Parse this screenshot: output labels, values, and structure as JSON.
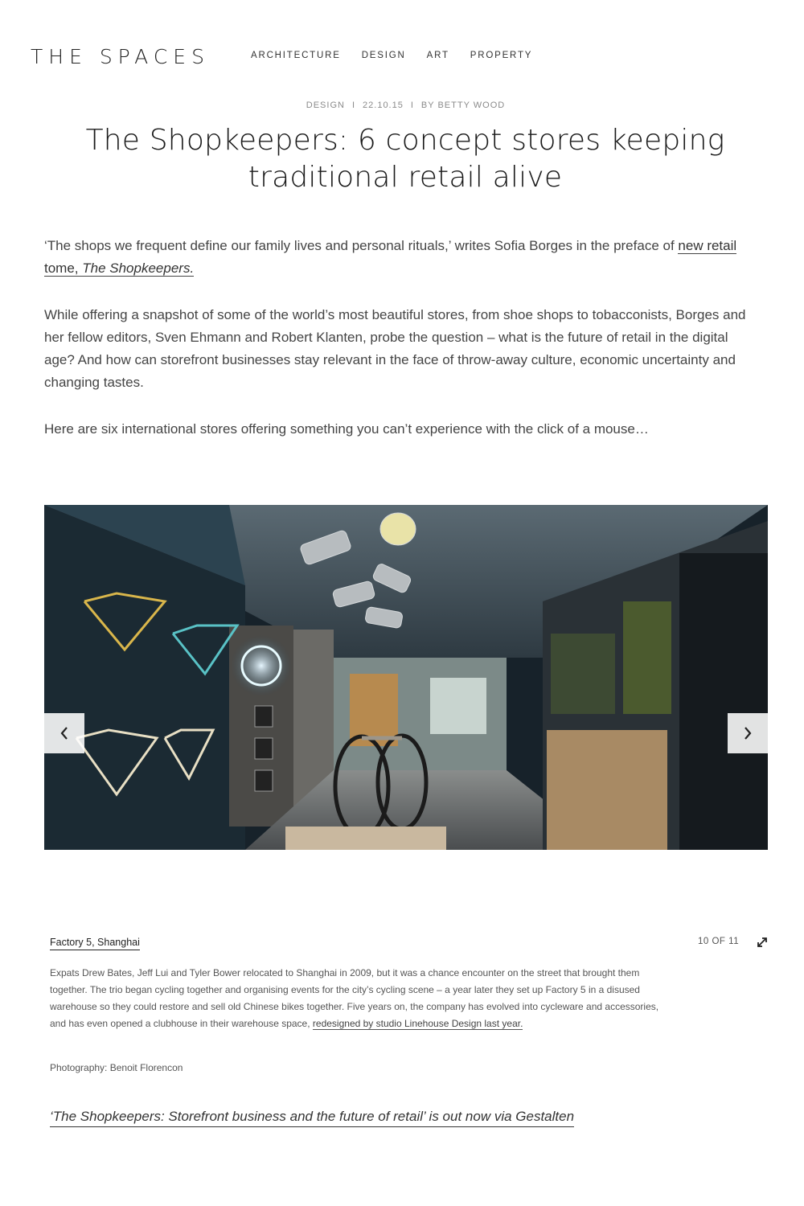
{
  "header": {
    "logo": "THE SPACES",
    "nav": [
      "ARCHITECTURE",
      "DESIGN",
      "ART",
      "PROPERTY"
    ]
  },
  "article": {
    "meta": {
      "category": "DESIGN",
      "separator": "I",
      "date": "22.10.15",
      "author": "BY BETTY WOOD"
    },
    "title": "The Shopkeepers: 6 concept stores keeping traditional retail alive",
    "intro1": {
      "text": "‘The shops we frequent define our family lives and personal rituals,’ writes Sofia Borges in the preface of ",
      "link_prefix": "new retail tome, ",
      "link_italic": "The Shopkeepers."
    },
    "intro2": "While offering a snapshot of some of the world’s most beautiful stores, from shoe shops to tobacconists, Borges and her fellow editors, Sven Ehmann and Robert Klanten, probe the question – what is the future of retail in the digital age? And how can storefront businesses stay relevant in the face of throw-away culture, economic uncertainty and changing tastes.",
    "intro3": "Here are six international stores offering something you can’t experience with the click of a mouse…"
  },
  "slideshow": {
    "image_icon": "bike-shop-interior-photo",
    "prev_icon": "chevron-left-icon",
    "next_icon": "chevron-right-icon",
    "expand_icon": "expand-icon",
    "counter": "10 OF 11",
    "caption_title": "Factory 5, Shanghai",
    "caption_text": "Expats Drew Bates, Jeff Lui and Tyler Bower relocated to Shanghai in 2009, but it was a chance encounter on the street that brought them together. The trio began cycling together and organising events for the city’s cycling scene – a year later they set up Factory 5 in a disused warehouse so they could restore and sell old Chinese bikes together. Five years on, the company has evolved into cycleware and accessories, and has even opened a clubhouse in their warehouse space, ",
    "caption_link": "redesigned by studio Linehouse Design last year.",
    "credit": "Photography: Benoit Florencon"
  },
  "footer_link": "‘The Shopkeepers: Storefront business and the future of retail’ is out now via Gestalten"
}
